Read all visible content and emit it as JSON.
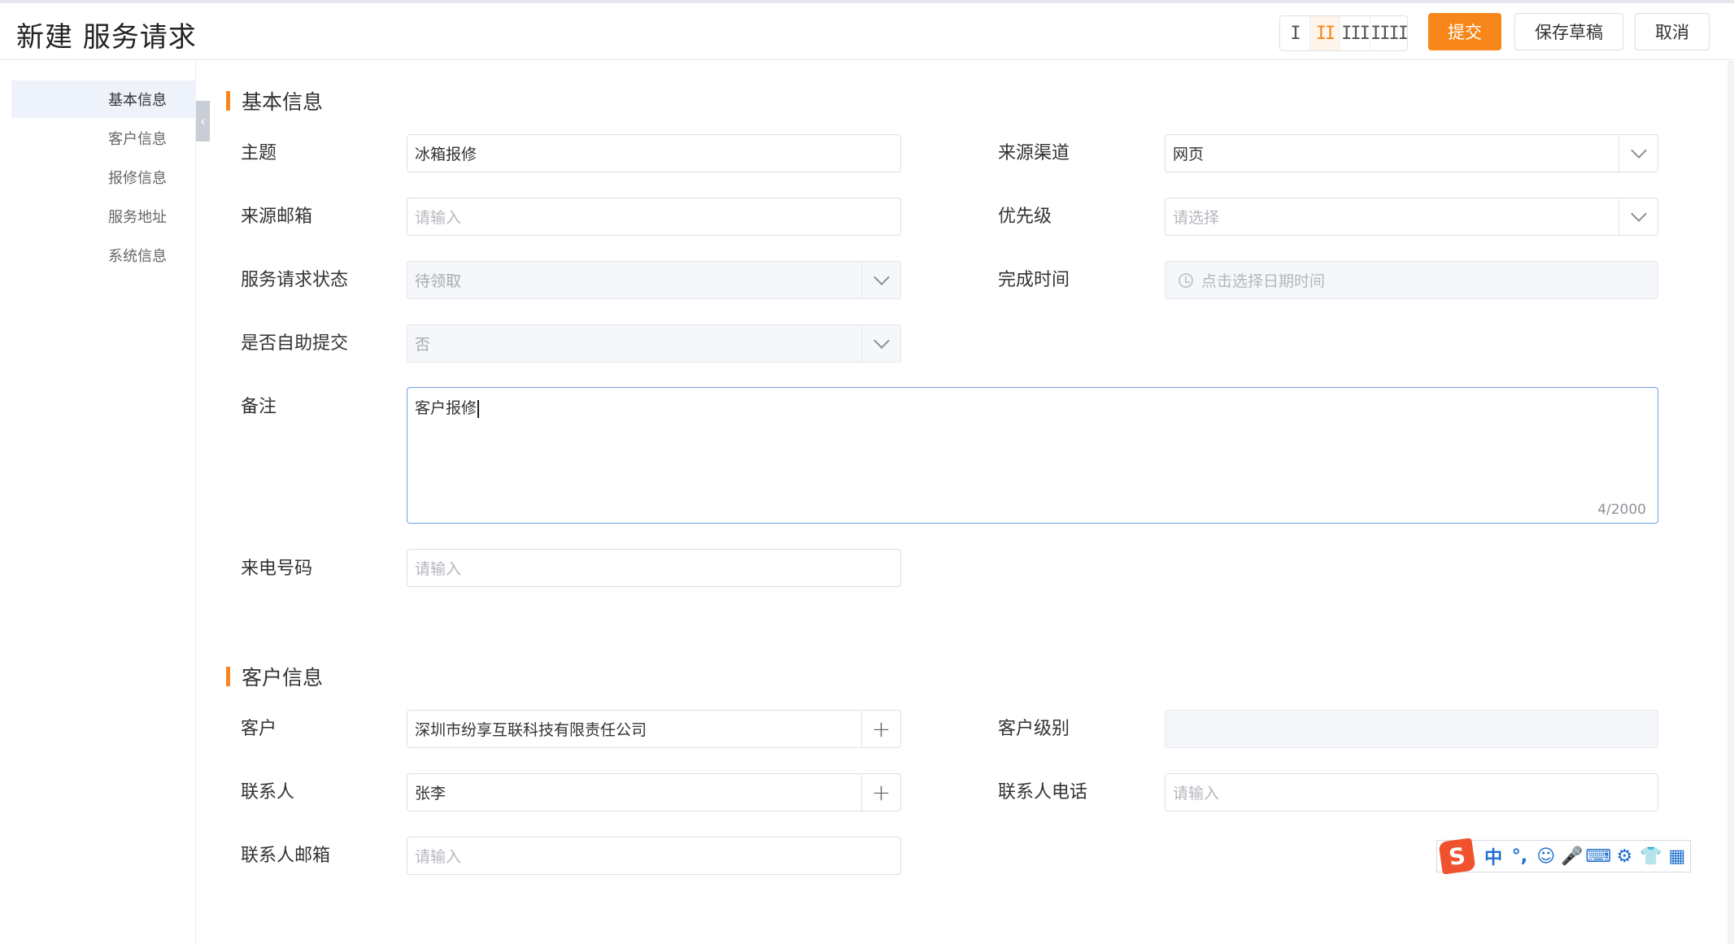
{
  "header": {
    "title": "新建 服务请求",
    "layouts": [
      "I",
      "II",
      "III",
      "IIII"
    ],
    "active_layout": 1,
    "submit_label": "提交",
    "draft_label": "保存草稿",
    "cancel_label": "取消"
  },
  "sidebar": {
    "items": [
      {
        "label": "基本信息"
      },
      {
        "label": "客户信息"
      },
      {
        "label": "报修信息"
      },
      {
        "label": "服务地址"
      },
      {
        "label": "系统信息"
      }
    ],
    "active": 0
  },
  "basic": {
    "title": "基本信息",
    "subject": {
      "label": "主题",
      "value": "冰箱报修"
    },
    "channel": {
      "label": "来源渠道",
      "value": "网页"
    },
    "email": {
      "label": "来源邮箱",
      "placeholder": "请输入"
    },
    "priority": {
      "label": "优先级",
      "placeholder": "请选择"
    },
    "status": {
      "label": "服务请求状态",
      "value": "待领取"
    },
    "finish_time": {
      "label": "完成时间",
      "placeholder": "点击选择日期时间"
    },
    "self_submit": {
      "label": "是否自助提交",
      "value": "否"
    },
    "remark": {
      "label": "备注",
      "value": "客户报修",
      "counter": "4/2000"
    },
    "phone": {
      "label": "来电号码",
      "placeholder": "请输入"
    }
  },
  "customer": {
    "title": "客户信息",
    "customer": {
      "label": "客户",
      "value": "深圳市纷享互联科技有限责任公司"
    },
    "level": {
      "label": "客户级别",
      "value": ""
    },
    "contact": {
      "label": "联系人",
      "value": "张李"
    },
    "contact_phone": {
      "label": "联系人电话",
      "placeholder": "请输入"
    },
    "contact_email": {
      "label": "联系人邮箱",
      "placeholder": "请输入"
    }
  },
  "ime_toolbar": {
    "logo": "S",
    "items": [
      "中",
      "°,",
      "☺",
      "🎤",
      "⌨",
      "⚙",
      "👕",
      "▦"
    ]
  },
  "colors": {
    "accent": "#f7871a",
    "focus": "#6f9fe8"
  }
}
